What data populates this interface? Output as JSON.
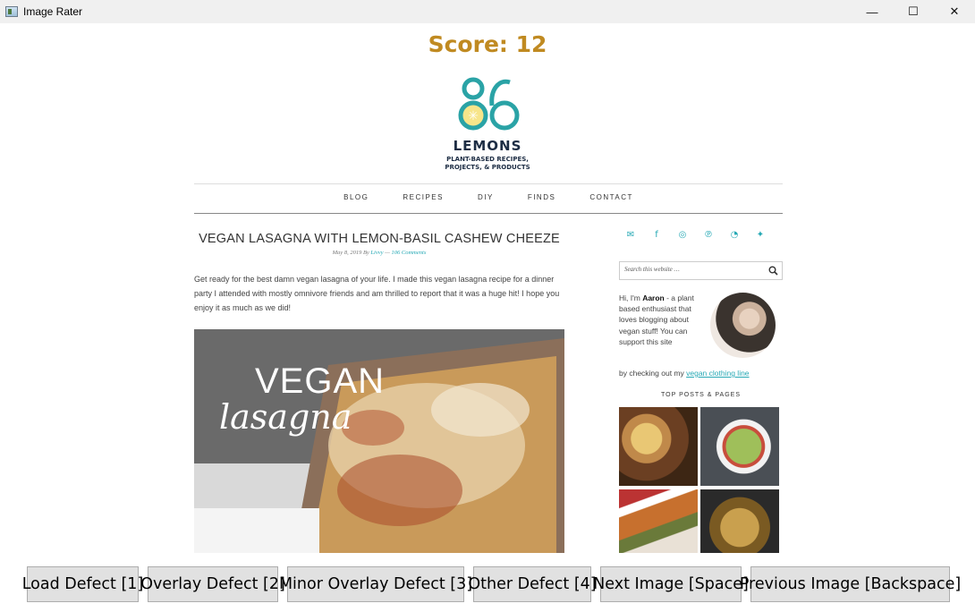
{
  "window": {
    "title": "Image Rater",
    "minimize_glyph": "—",
    "maximize_glyph": "☐",
    "close_glyph": "✕"
  },
  "score": {
    "label": "Score: 12"
  },
  "site": {
    "logo": {
      "number": "86",
      "word": "LEMONS",
      "tagline_1": "PLANT-BASED RECIPES,",
      "tagline_2": "PROJECTS, & PRODUCTS"
    },
    "nav": [
      "BLOG",
      "RECIPES",
      "DIY",
      "FINDS",
      "CONTACT"
    ],
    "post": {
      "title": "VEGAN LASAGNA WITH LEMON-BASIL CASHEW CHEEZE",
      "meta_date": "May 8, 2019 By ",
      "meta_author": "Livvy",
      "meta_sep": " — ",
      "meta_comments": "106 Comments",
      "body": "Get ready for the best damn vegan lasagna of your life. I made this vegan lasagna recipe for a dinner party I attended with mostly omnivore friends and am thrilled to report that it was a huge hit! I hope you enjoy it as much as we did!",
      "hero_line1": "VEGAN",
      "hero_line2": "lasagna"
    },
    "sidebar": {
      "social_icons": [
        "email-icon",
        "facebook-icon",
        "instagram-icon",
        "pinterest-icon",
        "rss-icon",
        "twitter-icon"
      ],
      "search_placeholder": "Search this website …",
      "about_hi": "Hi, I'm ",
      "about_name": "Aaron",
      "about_text": " - a plant based enthusiast that loves blogging about vegan stuff! You can support this site",
      "about_by": "by checking out my ",
      "about_link": "vegan clothing line",
      "top_posts": "TOP POSTS & PAGES"
    },
    "colors": {
      "accent": "#27a9b5",
      "score": "#c08a21",
      "logo_teal": "#2aa3a6",
      "logo_yellow": "#f7e58a"
    }
  },
  "buttons": {
    "load_defect": "Load Defect [1]",
    "overlay_defect": "Overlay Defect [2]",
    "minor_overlay_defect": "Minor Overlay Defect [3]",
    "other_defect": "Other Defect [4]",
    "next_image": "Next Image [Space]",
    "previous_image": "Previous Image [Backspace]"
  }
}
